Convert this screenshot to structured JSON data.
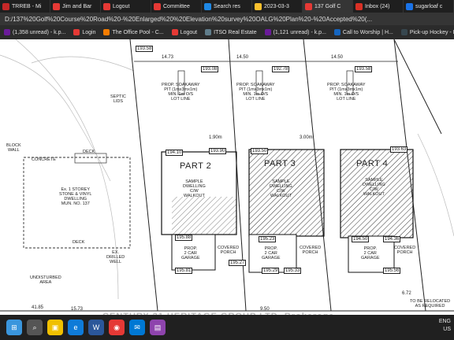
{
  "browser": {
    "tabs": [
      {
        "label": "TRREB - Mi",
        "color": "#c62828"
      },
      {
        "label": "Jim and Bar",
        "color": "#e53935"
      },
      {
        "label": "Logout",
        "color": "#e53935"
      },
      {
        "label": "Committee",
        "color": "#e53935"
      },
      {
        "label": "Search res",
        "color": "#1e88e5"
      },
      {
        "label": "2023-03-3",
        "color": "#fbc02d"
      },
      {
        "label": "137 Golf C",
        "color": "#e53935"
      },
      {
        "label": "Inbox (24)",
        "color": "#d93025"
      },
      {
        "label": "sugarloaf c",
        "color": "#1a73e8"
      }
    ],
    "url": "D:/137%20Golf%20Course%20Road%20-%20Enlarged%20%20Elevation%20survey%20OALG%20Plan%20-%20Accepted%20(...",
    "bookmarks": [
      {
        "label": "(1,358 unread) - k.p...",
        "color": "#6a1b9a"
      },
      {
        "label": "Login",
        "color": "#e53935"
      },
      {
        "label": "The Office Pool - C...",
        "color": "#f57c00"
      },
      {
        "label": "Logout",
        "color": "#e53935"
      },
      {
        "label": "ITSO Real Estate",
        "color": "#607d8b"
      },
      {
        "label": "(1,121 unread) - k.p...",
        "color": "#6a1b9a"
      },
      {
        "label": "Call to Worship | H...",
        "color": "#1565c0"
      },
      {
        "label": "Pick-up Hockey - Fr...",
        "color": "#37474f"
      }
    ]
  },
  "plan": {
    "lots": [
      "PART 2",
      "PART 3",
      "PART 4"
    ],
    "soakaway": "PROP. SOAKAWAY\nPIT (1mx3mx1m)\nMIN. 1m O/S\nLOT LINE",
    "dwelling_proposed": "SAMPLE\nDWELLING\nC/W\nWALKOUT",
    "garage": "PROP.\n2 CAR\nGARAGE",
    "porch": "COVERED\nPORCH",
    "existing_house": "Ex. 1 STOREY\nSTONE & VINYL\nDWELLING\nMUN. NO. 137",
    "septic": "SEPTIC\nLIDS",
    "deck": "DECK",
    "block_wall": "BLOCK\nWALL",
    "concrete": "CONCRETE",
    "drilled_well": "EX.\nDRILLED\nWELL",
    "undisturbed": "UNDISTURBED\nAREA",
    "relocate": "TO BE RELOCATED\nAS REQUIRED",
    "elevations": [
      "193.58",
      "193.08",
      "192.78",
      "193.58",
      "194.10",
      "193.90",
      "193.50",
      "193.63",
      "195.88",
      "195.23",
      "194.50",
      "194.36",
      "195.81",
      "195.27",
      "195.29",
      "195.33",
      "195.56"
    ],
    "dims": [
      "14.73",
      "14.50",
      "14.50",
      "15.73",
      "9.50",
      "6.72",
      "41.85",
      "1.90m",
      "3.00m"
    ]
  },
  "watermark": "CENTURY 21 HERITAGE GROUP LTD. Brokerage",
  "taskbar": {
    "lang": "ENG",
    "region": "US",
    "icons": [
      "windows-icon",
      "search-icon",
      "explorer-icon",
      "edge-icon",
      "word-icon",
      "chrome-icon",
      "mail-icon",
      "photos-icon"
    ]
  }
}
